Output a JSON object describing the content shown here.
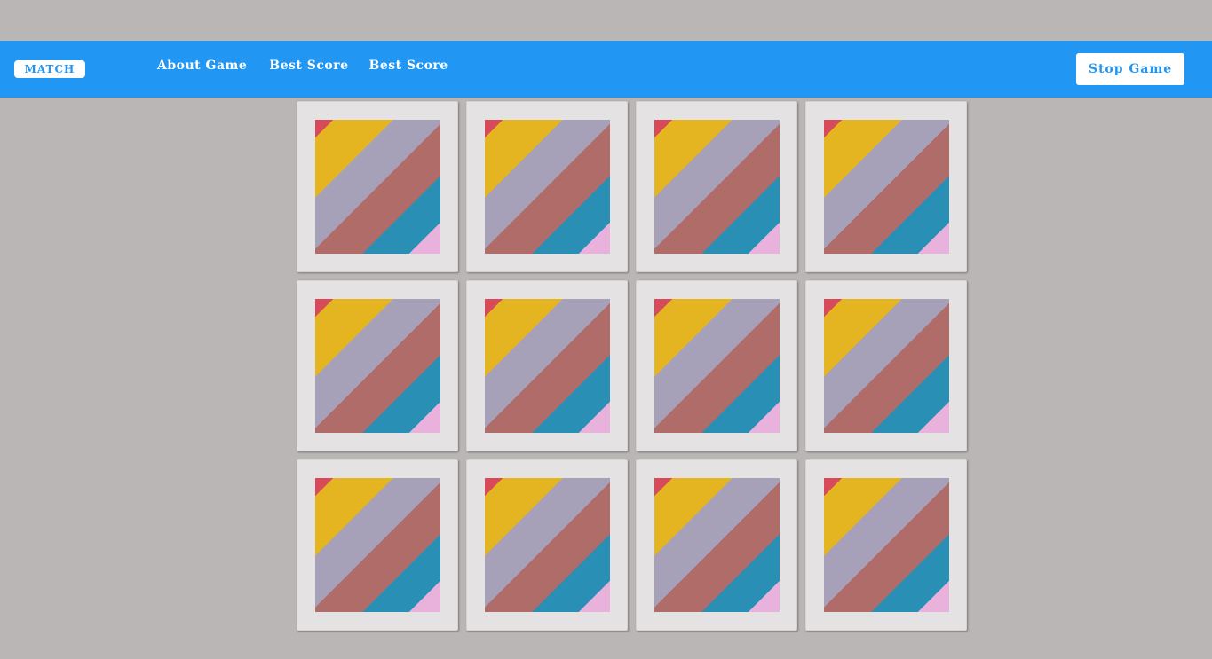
{
  "header": {
    "logo": "MATCH",
    "nav": [
      {
        "label": "About Game"
      },
      {
        "label": "Best Score"
      },
      {
        "label": "Best Score"
      }
    ],
    "stop_button": "Stop Game"
  },
  "colors": {
    "background": "#bab6b5",
    "header": "#2196f3",
    "card": "#e4e2e2",
    "stripes": [
      "#d84a5a",
      "#e4b520",
      "#a6a0b8",
      "#b06c68",
      "#2a8fb4",
      "#e8b2dc"
    ]
  },
  "cards": [
    {
      "face": "card-back"
    },
    {
      "face": "card-back"
    },
    {
      "face": "card-back"
    },
    {
      "face": "card-back"
    },
    {
      "face": "card-back"
    },
    {
      "face": "card-back"
    },
    {
      "face": "card-back"
    },
    {
      "face": "card-back"
    },
    {
      "face": "card-back"
    },
    {
      "face": "card-back"
    },
    {
      "face": "card-back"
    },
    {
      "face": "card-back"
    }
  ]
}
